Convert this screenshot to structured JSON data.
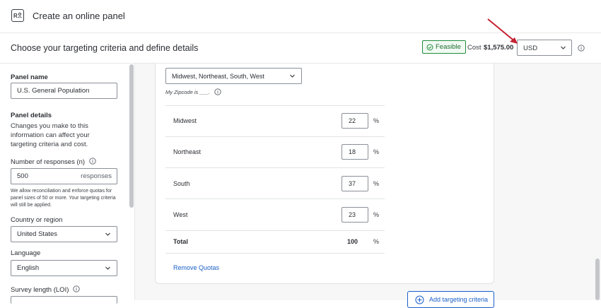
{
  "app": {
    "title": "Create an online panel"
  },
  "header": {
    "title": "Choose your targeting criteria and define details",
    "feasible_label": "Feasible",
    "cost_label": "Cost",
    "cost_value": "$1,575.00",
    "currency": "USD",
    "colors": {
      "feasible": "#1e8c3a",
      "link": "#1a5fc7",
      "arrow": "#c62032"
    }
  },
  "sidebar": {
    "panel_name_label": "Panel name",
    "panel_name_value": "U.S. General Population",
    "panel_details_label": "Panel details",
    "panel_details_text": "Changes you make to this information can affect your targeting criteria and cost.",
    "responses_label": "Number of responses (n)",
    "responses_value": "500",
    "responses_suffix": "responses",
    "responses_note": "We allow reconciliation and enforce quotas for panel sizes of 50 or more. Your targeting criteria will still be applied.",
    "country_label": "Country or region",
    "country_value": "United States",
    "language_label": "Language",
    "language_value": "English",
    "loi_label": "Survey length (LOI)"
  },
  "targeting": {
    "region_selected": "Midwest, Northeast, South, West",
    "hint": "My Zipcode is ___.",
    "rows": [
      {
        "label": "Midwest",
        "value": "22",
        "unit": "%"
      },
      {
        "label": "Northeast",
        "value": "18",
        "unit": "%"
      },
      {
        "label": "South",
        "value": "37",
        "unit": "%"
      },
      {
        "label": "West",
        "value": "23",
        "unit": "%"
      }
    ],
    "total_label": "Total",
    "total_value": "100",
    "total_unit": "%",
    "remove_quotas": "Remove Quotas",
    "add_criteria": "Add targeting criteria"
  }
}
